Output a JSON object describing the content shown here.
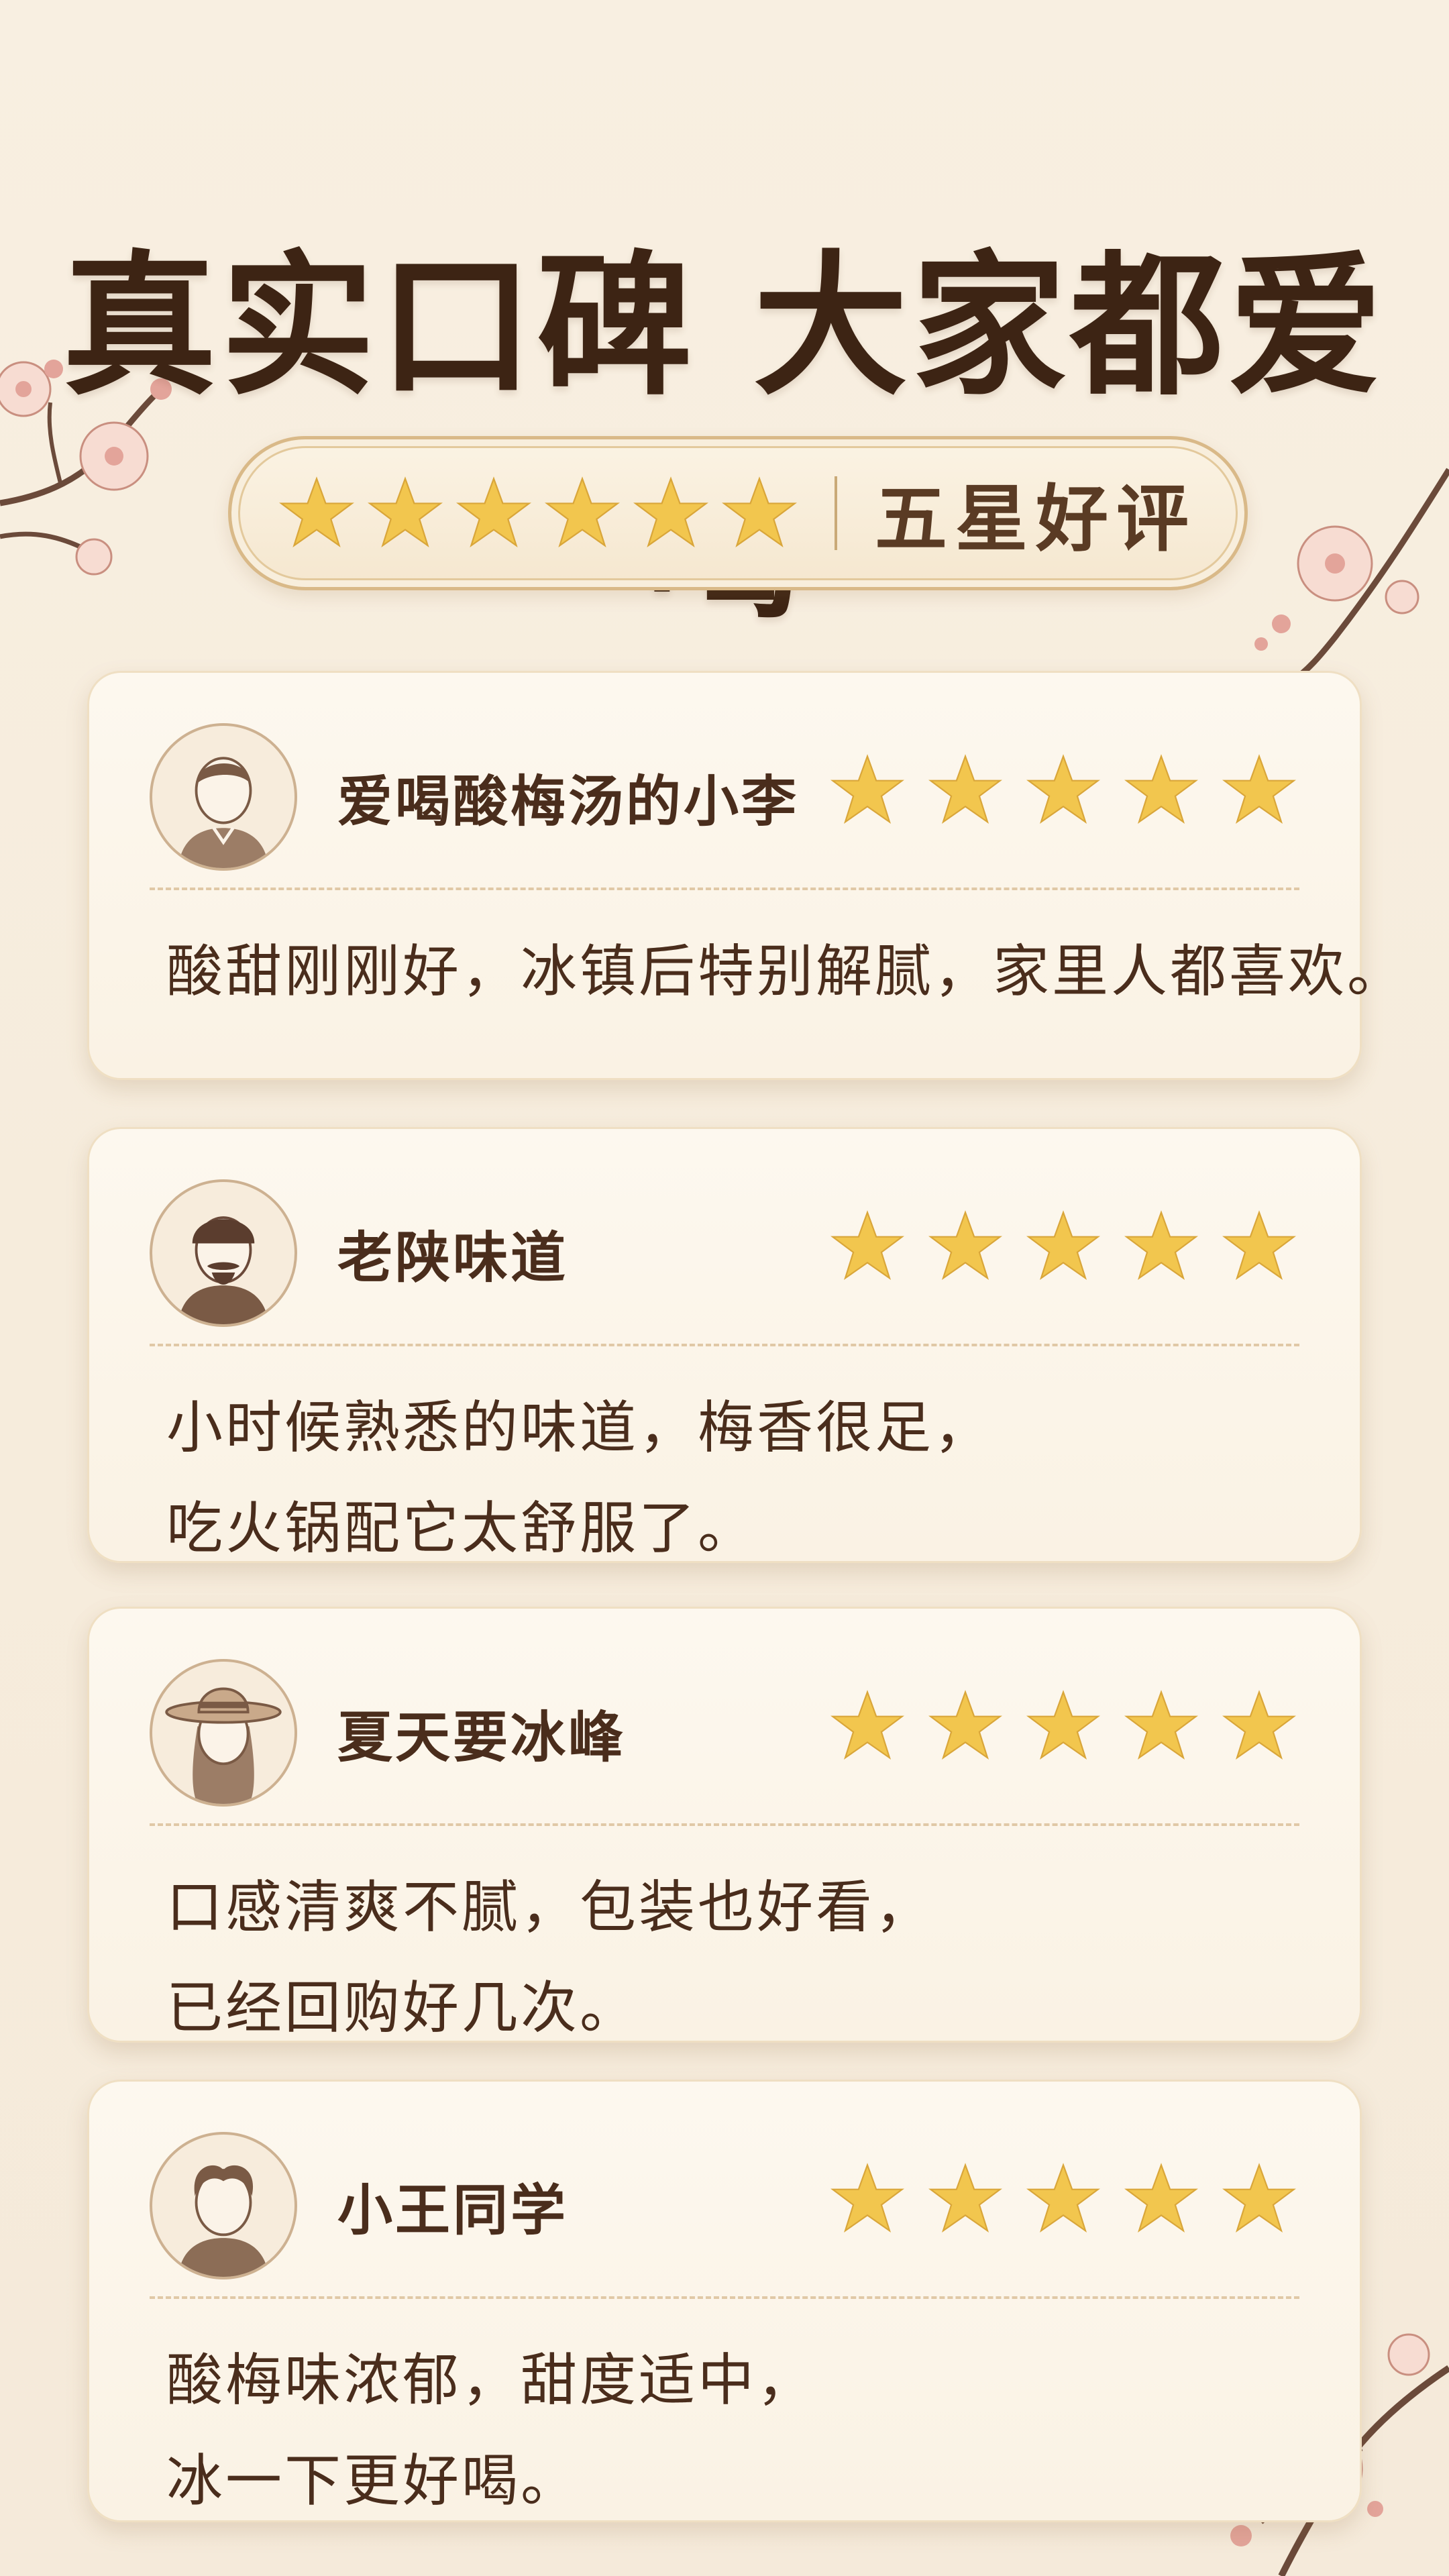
{
  "headline": "真实口碑 大家都爱喝",
  "badge": {
    "rating_stars": 6,
    "label": "五星好评"
  },
  "colors": {
    "star": "#f2c64e",
    "text": "#4a2d1c",
    "card": "#fdf8ef",
    "border": "#d9b988"
  },
  "reviews": [
    {
      "name": "爱喝酸梅汤的小李",
      "rating": 5,
      "avatar": "man-short-hair-icon",
      "lines": [
        "酸甜刚刚好，冰镇后特别解腻，家里人都喜欢。"
      ]
    },
    {
      "name": "老陕味道",
      "rating": 5,
      "avatar": "man-cap-mustache-icon",
      "lines": [
        "小时候熟悉的味道，梅香很足，",
        "吃火锅配它太舒服了。"
      ]
    },
    {
      "name": "夏天要冰峰",
      "rating": 5,
      "avatar": "woman-sunhat-icon",
      "lines": [
        "口感清爽不腻，包装也好看，",
        "已经回购好几次。"
      ]
    },
    {
      "name": "小王同学",
      "rating": 5,
      "avatar": "boy-curly-hair-icon",
      "lines": [
        "酸梅味浓郁，甜度适中，",
        "冰一下更好喝。"
      ]
    }
  ]
}
